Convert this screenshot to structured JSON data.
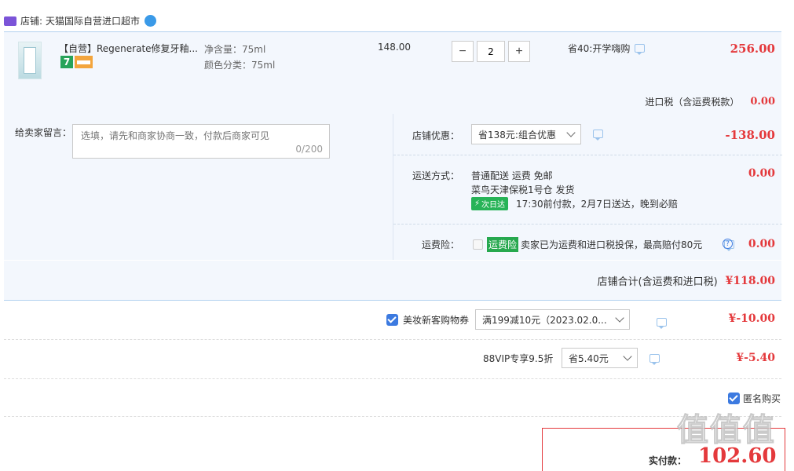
{
  "store": {
    "label": "店铺:",
    "name": "天猫国际自营进口超市"
  },
  "item": {
    "title": "【自营】Regenerate修复牙釉...",
    "badge_7": "7",
    "spec_volume": "净含量：75ml",
    "spec_color": "颜色分类：75ml",
    "unit_price": "148.00",
    "quantity": "2",
    "discount": "省40:开学嗨购",
    "subtotal": "256.00"
  },
  "tax": {
    "label": "进口税（含运费税款）",
    "value": "0.00"
  },
  "message": {
    "label": "给卖家留言：",
    "placeholder": "选填，请先和商家协商一致，付款后商家可见",
    "counter": "0/200"
  },
  "shop_promo": {
    "label": "店铺优惠：",
    "selected": "省138元:组合优惠",
    "value": "-138.00"
  },
  "shipping": {
    "label": "运送方式：",
    "line1": "普通配送 运费 免邮",
    "line2": "菜鸟天津保税1号仓  发货",
    "next_day_badge": "次日达",
    "note": "17:30前付款，2月7日送达，晚到必赔",
    "value": "0.00"
  },
  "freight_insurance": {
    "label": "运费险：",
    "badge": "运费险",
    "desc": "卖家已为运费和进口税投保，最高赔付80元",
    "value": "0.00"
  },
  "store_total": {
    "label": "店铺合计(含运费和进口税)",
    "value": "¥118.00"
  },
  "coupon": {
    "label": "美妆新客购物券",
    "selected": "满199减10元（2023.02.0...",
    "value": "¥-10.00"
  },
  "vip": {
    "label": "88VIP专享9.5折",
    "selected": "省5.40元",
    "value": "¥-5.40"
  },
  "anonymous": {
    "label": "匿名购买"
  },
  "payment": {
    "label": "实付款：",
    "value": "102.60"
  },
  "watermark": "值 值 值",
  "colors": {
    "accent_red": "#e4393c",
    "panel_bg": "#f3f7fd",
    "link_blue": "#3c7ae0"
  }
}
